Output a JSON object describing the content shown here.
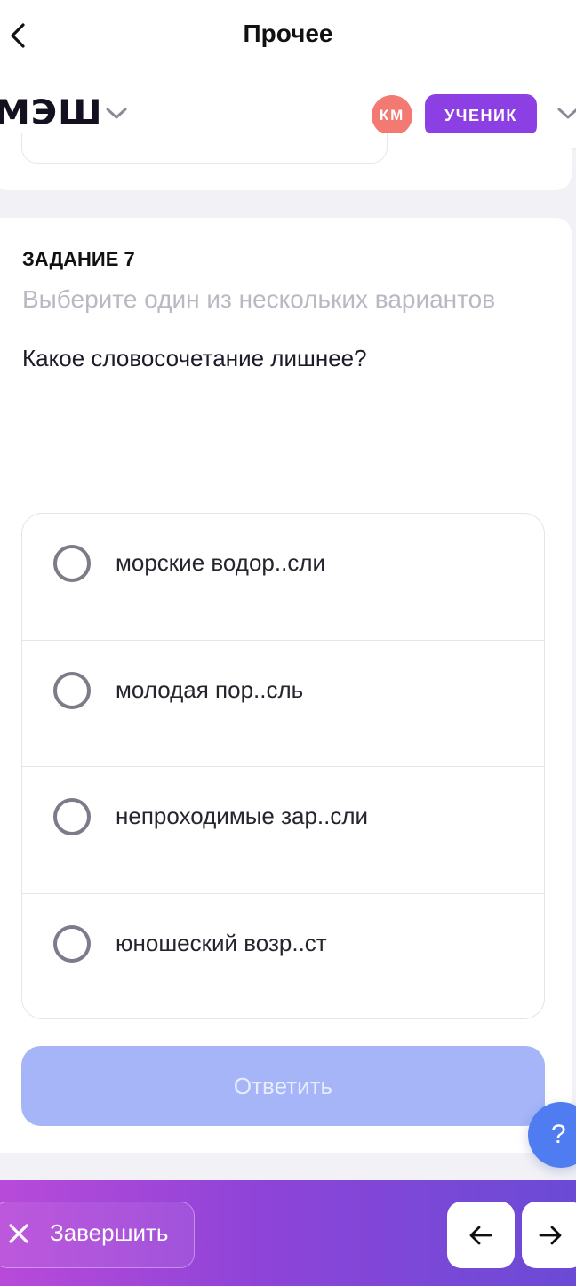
{
  "topbar": {
    "title": "Прочее",
    "back_icon": "chevron-left-icon"
  },
  "header": {
    "logo_text": "МЭШ",
    "avatar_initials": "КМ",
    "avatar_color": "#f27a73",
    "role_label": "УЧЕНИК",
    "role_color": "#8c3fe3"
  },
  "task": {
    "label": "ЗАДАНИЕ 7",
    "hint": "Выберите один из нескольких вариантов",
    "question": "Какое словосочетание лишнее?",
    "options": [
      {
        "label": "морские водор..сли"
      },
      {
        "label": "молодая пор..сль"
      },
      {
        "label": "непроходимые зар..сли"
      },
      {
        "label": "юношеский возр..ст"
      }
    ],
    "answer_label": "Ответить",
    "answer_color": "#a5b5f7"
  },
  "help": {
    "label": "?"
  },
  "bottombar": {
    "finish_label": "Завершить",
    "prev_icon": "arrow-left-icon",
    "next_icon": "arrow-right-icon"
  }
}
